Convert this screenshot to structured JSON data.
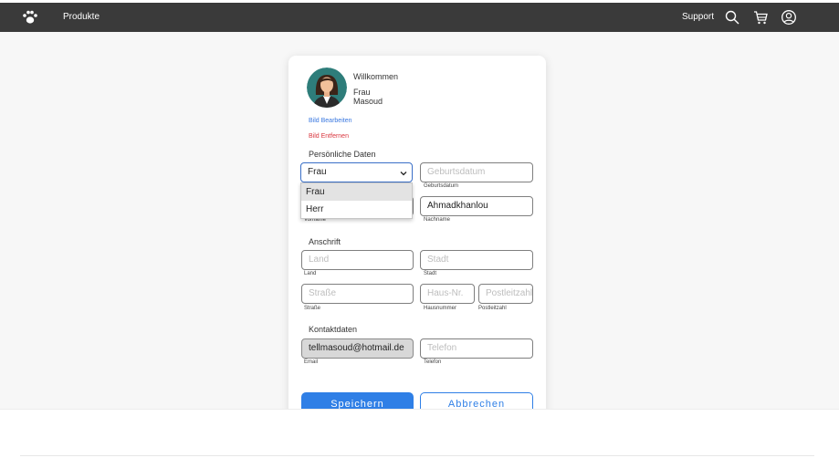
{
  "nav": {
    "products": "Produkte",
    "support": "Support",
    "icons": [
      "paw-logo-icon",
      "search-icon",
      "cart-icon",
      "user-icon"
    ]
  },
  "profile": {
    "welcome": "Willkommen",
    "salutation": "Frau",
    "last_name": "Masoud",
    "edit_picture": "Bild Bearbeiten",
    "remove_picture": "Bild Entfernen"
  },
  "personal": {
    "heading": "Persönliche Daten",
    "salutation_value": "Frau",
    "salutation_options": [
      "Frau",
      "Herr"
    ],
    "birthdate_placeholder": "Geburtsdatum",
    "birthdate_hint": "Geburtsdatum",
    "firstname_hint": "Vorname",
    "lastname_value": "Ahmadkhanlou",
    "lastname_hint": "Nachname"
  },
  "address": {
    "heading": "Anschrift",
    "country_placeholder": "Land",
    "country_hint": "Land",
    "city_placeholder": "Stadt",
    "city_hint": "Stadt",
    "street_placeholder": "Straße",
    "street_hint": "Straße",
    "house_placeholder": "Haus-Nr.",
    "house_hint": "Hausnummer",
    "zip_placeholder": "Postleitzahl",
    "zip_hint": "Postleitzahl"
  },
  "contact": {
    "heading": "Kontaktdaten",
    "email_value": "tellmasoud@hotmail.de",
    "email_hint": "Email",
    "phone_placeholder": "Telefon",
    "phone_hint": "Telefon"
  },
  "actions": {
    "save": "Speichern",
    "cancel": "Abbrechen"
  },
  "colors": {
    "navbar": "#3a3a3a",
    "primary": "#2f7fe6",
    "danger": "#d9363e"
  }
}
